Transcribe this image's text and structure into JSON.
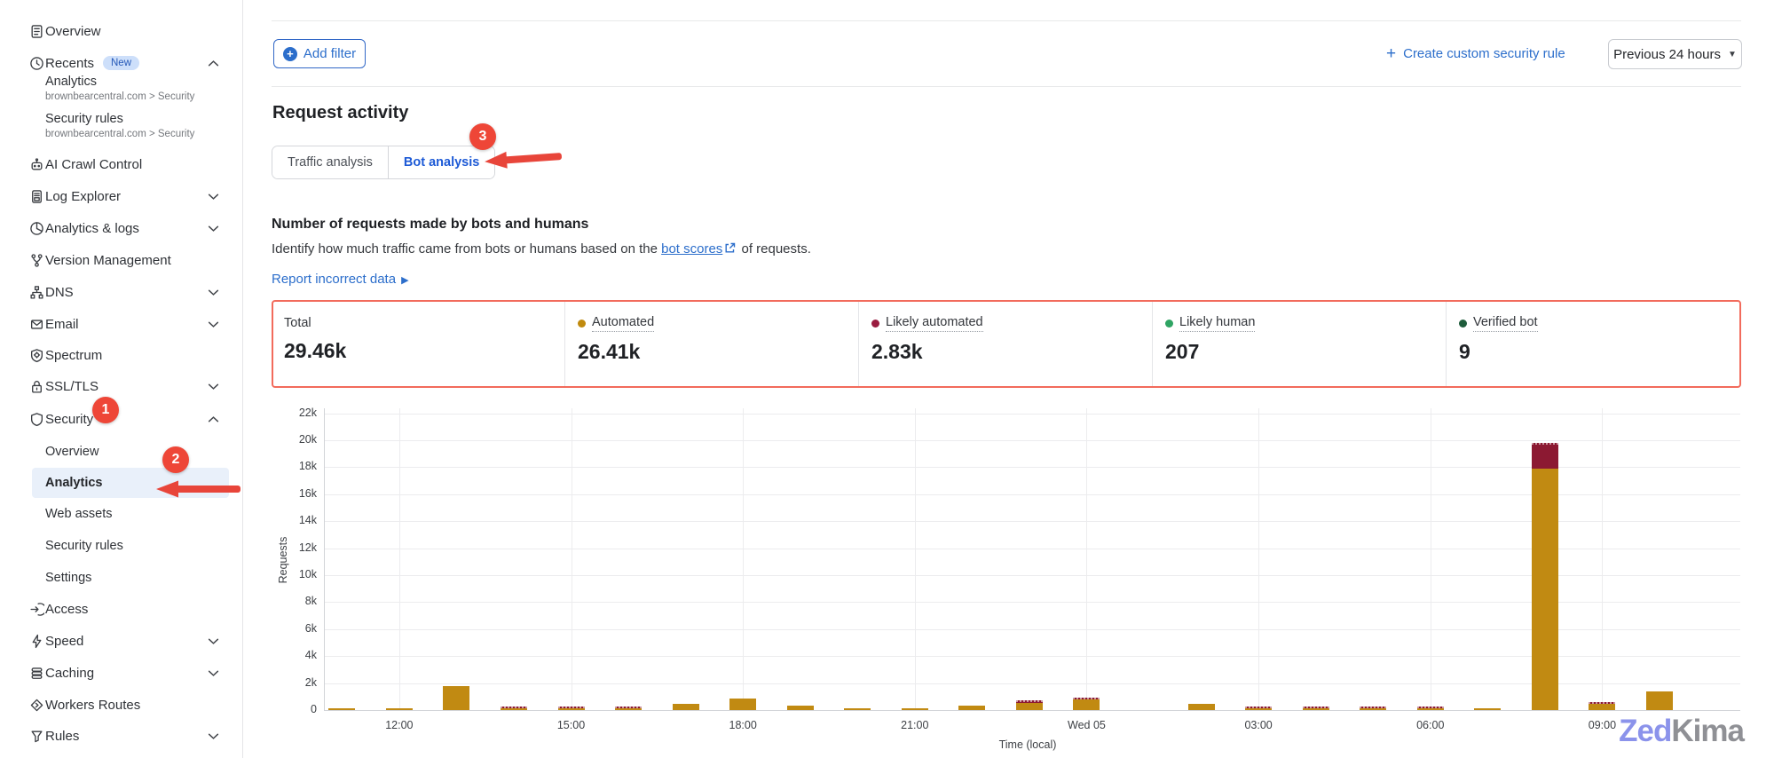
{
  "sidebar": {
    "items": [
      {
        "label": "Overview",
        "icon": "document-icon"
      },
      {
        "label": "Recents",
        "icon": "clock-icon",
        "badge": "New",
        "chevron": "up"
      },
      {
        "label": "AI Crawl Control",
        "icon": "robot-icon"
      },
      {
        "label": "Log Explorer",
        "icon": "log-file-icon",
        "chevron": "down"
      },
      {
        "label": "Analytics & logs",
        "icon": "pie-chart-icon",
        "chevron": "down"
      },
      {
        "label": "Version Management",
        "icon": "branch-icon"
      },
      {
        "label": "DNS",
        "icon": "network-icon",
        "chevron": "down"
      },
      {
        "label": "Email",
        "icon": "envelope-icon",
        "chevron": "down"
      },
      {
        "label": "Spectrum",
        "icon": "spectrum-shield-icon"
      },
      {
        "label": "SSL/TLS",
        "icon": "lock-icon",
        "chevron": "down"
      },
      {
        "label": "Security",
        "icon": "shield-icon",
        "chevron": "up"
      },
      {
        "label": "Access",
        "icon": "access-icon"
      },
      {
        "label": "Speed",
        "icon": "bolt-icon",
        "chevron": "down"
      },
      {
        "label": "Caching",
        "icon": "cache-icon",
        "chevron": "down"
      },
      {
        "label": "Workers Routes",
        "icon": "workers-icon"
      },
      {
        "label": "Rules",
        "icon": "funnel-icon",
        "chevron": "down"
      }
    ],
    "recents": [
      {
        "title": "Analytics",
        "breadcrumb": "brownbearcentral.com > Security"
      },
      {
        "title": "Security rules",
        "breadcrumb": "brownbearcentral.com > Security"
      }
    ],
    "security_subitems": [
      "Overview",
      "Analytics",
      "Web assets",
      "Security rules",
      "Settings"
    ],
    "selected_subitem": "Analytics"
  },
  "toolbar": {
    "add_filter": "Add filter",
    "create_rule": "Create custom security rule",
    "time_range": "Previous 24 hours"
  },
  "request_activity": {
    "title": "Request activity",
    "tabs": [
      {
        "label": "Traffic analysis",
        "active": false
      },
      {
        "label": "Bot analysis",
        "active": true
      }
    ]
  },
  "section": {
    "heading": "Number of requests made by bots and humans",
    "desc_before": "Identify how much traffic came from bots or humans based on the ",
    "desc_link": "bot scores",
    "desc_after": " of requests.",
    "report_link": "Report incorrect data"
  },
  "stats": [
    {
      "label": "Total",
      "value": "29.46k",
      "dot": null
    },
    {
      "label": "Automated",
      "value": "26.41k",
      "dot": "#C08A0E"
    },
    {
      "label": "Likely automated",
      "value": "2.83k",
      "dot": "#9A1C40"
    },
    {
      "label": "Likely human",
      "value": "207",
      "dot": "#2FA463"
    },
    {
      "label": "Verified bot",
      "value": "9",
      "dot": "#1E5C3B"
    }
  ],
  "chart_data": {
    "type": "bar",
    "stacked": true,
    "x": [
      "11:00",
      "12:00",
      "13:00",
      "14:00",
      "15:00",
      "16:00",
      "17:00",
      "18:00",
      "19:00",
      "20:00",
      "21:00",
      "22:00",
      "23:00",
      "00:00",
      "01:00",
      "02:00",
      "03:00",
      "04:00",
      "05:00",
      "06:00",
      "07:00",
      "08:00",
      "09:00",
      "10:00"
    ],
    "x_ticks": [
      {
        "index": 1,
        "label": "12:00"
      },
      {
        "index": 4,
        "label": "15:00"
      },
      {
        "index": 7,
        "label": "18:00"
      },
      {
        "index": 10,
        "label": "21:00"
      },
      {
        "index": 13,
        "label": "Wed 05"
      },
      {
        "index": 16,
        "label": "03:00"
      },
      {
        "index": 19,
        "label": "06:00"
      },
      {
        "index": 22,
        "label": "09:00"
      }
    ],
    "series": [
      {
        "name": "Automated",
        "color": "#C18A12",
        "values_k": [
          0.05,
          0.12,
          1.8,
          0.15,
          0.04,
          0.03,
          0.45,
          0.85,
          0.3,
          0.12,
          0.1,
          0.35,
          0.55,
          0.8,
          0,
          0.45,
          0.02,
          0.05,
          0.15,
          0.08,
          0.06,
          17.9,
          0.45,
          1.4
        ]
      },
      {
        "name": "Likely automated",
        "color": "#8C1932",
        "values_k": [
          0,
          0,
          0,
          0.03,
          0.04,
          0.1,
          0,
          0,
          0,
          0,
          0,
          0,
          0.15,
          0.08,
          0,
          0,
          0.04,
          0.12,
          0.02,
          0.02,
          0,
          1.9,
          0.12,
          0
        ]
      }
    ],
    "yticks": [
      "0",
      "2k",
      "4k",
      "6k",
      "8k",
      "10k",
      "12k",
      "14k",
      "16k",
      "18k",
      "20k",
      "22k"
    ],
    "ylim_k": [
      0,
      22
    ],
    "ylabel": "Requests",
    "xlabel": "Time (local)",
    "grid": true,
    "legend_position": "none"
  },
  "annotations": {
    "step1": "1",
    "step2": "2",
    "step3": "3"
  },
  "watermark": {
    "part1": "Zed",
    "part2": "Kima"
  }
}
